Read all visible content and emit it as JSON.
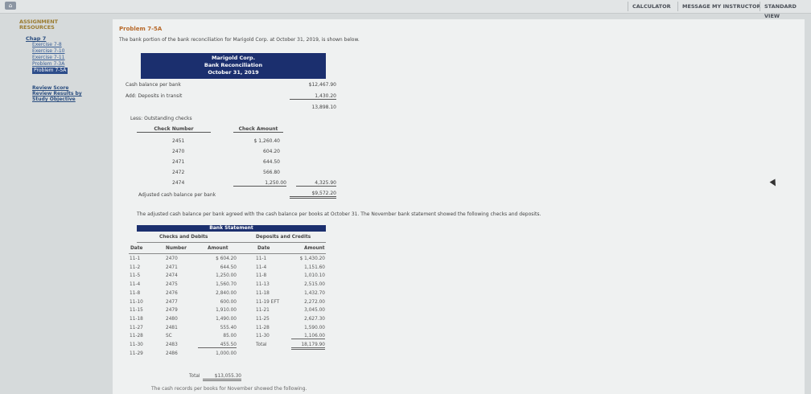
{
  "topbar": {
    "calculator": "CALCULATOR",
    "message_instructor": "MESSAGE MY INSTRUCTOR",
    "standard_view": "STANDARD VIEW"
  },
  "sidebar": {
    "heading_line1": "ASSIGNMENT",
    "heading_line2": "RESOURCES",
    "chapter": "Chap 7",
    "items": [
      {
        "label": "Exercise 7-8",
        "active": false
      },
      {
        "label": "Exercise 7-10",
        "active": false
      },
      {
        "label": "Exercise 7-11",
        "active": false
      },
      {
        "label": "Problem 7-3A",
        "active": false
      },
      {
        "label": "Problem 7-5A",
        "active": true
      }
    ],
    "review_score": "Review Score",
    "review_results_line1": "Review Results by",
    "review_results_line2": "Study Objective"
  },
  "problem": {
    "title": "Problem 7-5A",
    "intro": "The bank portion of the bank reconciliation for Marigold Corp. at October 31, 2019, is shown below."
  },
  "reconciliation": {
    "header_line1": "Marigold Corp.",
    "header_line2": "Bank Reconciliation",
    "header_line3": "October 31, 2019",
    "cash_balance_label": "Cash balance per bank",
    "cash_balance_value": "$12,467.90",
    "deposits_label": "Add: Deposits in transit",
    "deposits_value": "1,430.20",
    "subtotal": "13,898.10",
    "less_label": "Less: Outstanding checks",
    "col_check_number": "Check Number",
    "col_check_amount": "Check Amount",
    "checks": [
      {
        "number": "2451",
        "amount": "$ 1,260.40"
      },
      {
        "number": "2470",
        "amount": "604.20"
      },
      {
        "number": "2471",
        "amount": "644.50"
      },
      {
        "number": "2472",
        "amount": "566.80"
      },
      {
        "number": "2474",
        "amount": "1,250.00"
      }
    ],
    "checks_total": "4,325.90",
    "adjusted_label": "Adjusted cash balance per bank",
    "adjusted_value": "$9,572.20"
  },
  "para2": "The adjusted cash balance per bank agreed with the cash balance per books at October 31. The November bank statement showed the following checks and deposits.",
  "bank_statement": {
    "title": "Bank Statement",
    "checks_group": "Checks and Debits",
    "deposits_group": "Deposits and Credits",
    "col_date": "Date",
    "col_number": "Number",
    "col_amount": "Amount",
    "col_dep_date": "Date",
    "col_dep_amount": "Amount",
    "rows": [
      {
        "date": "11-1",
        "number": "2470",
        "amount": "$ 604.20",
        "dep_date": "11-1",
        "dep_amount": "$ 1,430.20"
      },
      {
        "date": "11-2",
        "number": "2471",
        "amount": "644.50",
        "dep_date": "11-4",
        "dep_amount": "1,151.60"
      },
      {
        "date": "11-5",
        "number": "2474",
        "amount": "1,250.00",
        "dep_date": "11-8",
        "dep_amount": "1,010.10"
      },
      {
        "date": "11-4",
        "number": "2475",
        "amount": "1,560.70",
        "dep_date": "11-13",
        "dep_amount": "2,515.00"
      },
      {
        "date": "11-8",
        "number": "2476",
        "amount": "2,840.00",
        "dep_date": "11-18",
        "dep_amount": "1,432.70"
      },
      {
        "date": "11-10",
        "number": "2477",
        "amount": "600.00",
        "dep_date": "11-19 EFT",
        "dep_amount": "2,272.00"
      },
      {
        "date": "11-15",
        "number": "2479",
        "amount": "1,910.00",
        "dep_date": "11-21",
        "dep_amount": "3,045.00"
      },
      {
        "date": "11-18",
        "number": "2480",
        "amount": "1,490.00",
        "dep_date": "11-25",
        "dep_amount": "2,627.30"
      },
      {
        "date": "11-27",
        "number": "2481",
        "amount": "555.40",
        "dep_date": "11-28",
        "dep_amount": "1,590.00"
      },
      {
        "date": "11-28",
        "number": "SC",
        "amount": "85.00",
        "dep_date": "11-30",
        "dep_amount": "1,106.00"
      },
      {
        "date": "11-30",
        "number": "2483",
        "amount": "455.50",
        "dep_date": "Total",
        "dep_amount": "18,179.90"
      },
      {
        "date": "11-29",
        "number": "2486",
        "amount": "1,000.00",
        "dep_date": "",
        "dep_amount": ""
      }
    ],
    "total_label": "Total",
    "total_value": "$13,055.30"
  },
  "footer_note": "The cash records per books for November showed the following."
}
